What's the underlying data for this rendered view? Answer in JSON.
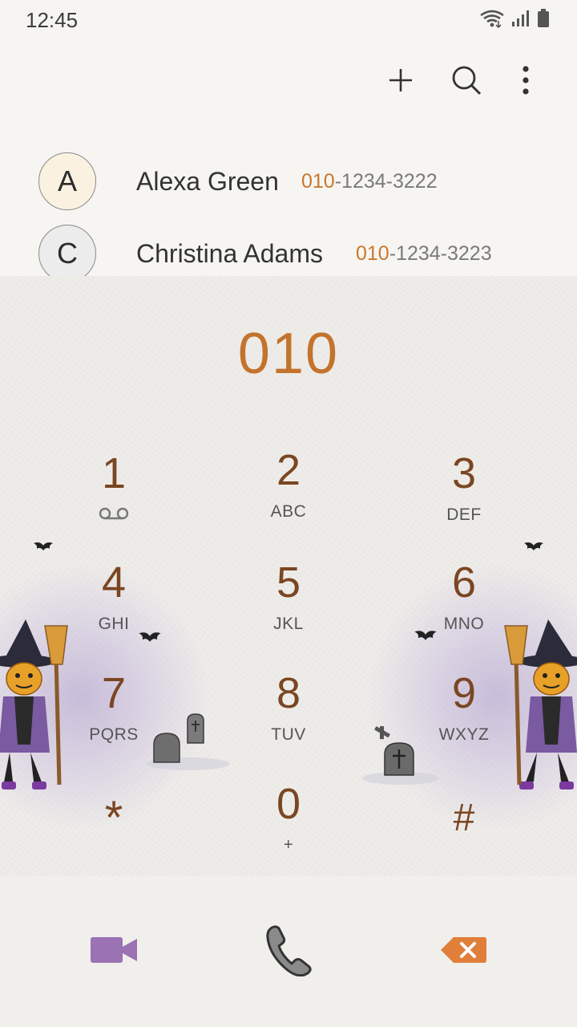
{
  "status_bar": {
    "time": "12:45",
    "icons": [
      "wifi-icon",
      "signal-icon",
      "battery-icon"
    ]
  },
  "top_bar": {
    "actions": [
      "add-icon",
      "search-icon",
      "more-options-icon"
    ]
  },
  "suggestions": [
    {
      "initial": "A",
      "name": "Alexa Green",
      "number_match": "010",
      "number_rest": "-1234-3222"
    },
    {
      "initial": "C",
      "name": "Christina Adams",
      "number_match": "010",
      "number_rest": "-1234-3223"
    }
  ],
  "dialer": {
    "entered_number": "010",
    "keys": [
      {
        "digit": "1",
        "letters": "",
        "sub_icon": "voicemail-icon"
      },
      {
        "digit": "2",
        "letters": "ABC"
      },
      {
        "digit": "3",
        "letters": "DEF"
      },
      {
        "digit": "4",
        "letters": "GHI"
      },
      {
        "digit": "5",
        "letters": "JKL"
      },
      {
        "digit": "6",
        "letters": "MNO"
      },
      {
        "digit": "7",
        "letters": "PQRS"
      },
      {
        "digit": "8",
        "letters": "TUV"
      },
      {
        "digit": "9",
        "letters": "WXYZ"
      },
      {
        "digit": "*",
        "letters": ""
      },
      {
        "digit": "0",
        "letters": "+"
      },
      {
        "digit": "#",
        "letters": ""
      }
    ]
  },
  "bottom_bar": {
    "actions": [
      "video-call-icon",
      "phone-call-icon",
      "backspace-icon"
    ]
  },
  "colors": {
    "accent": "#c4732d",
    "digit": "#7a4622",
    "video": "#9b72b3",
    "backspace": "#e07f3a",
    "background": "#f6f5f2"
  }
}
